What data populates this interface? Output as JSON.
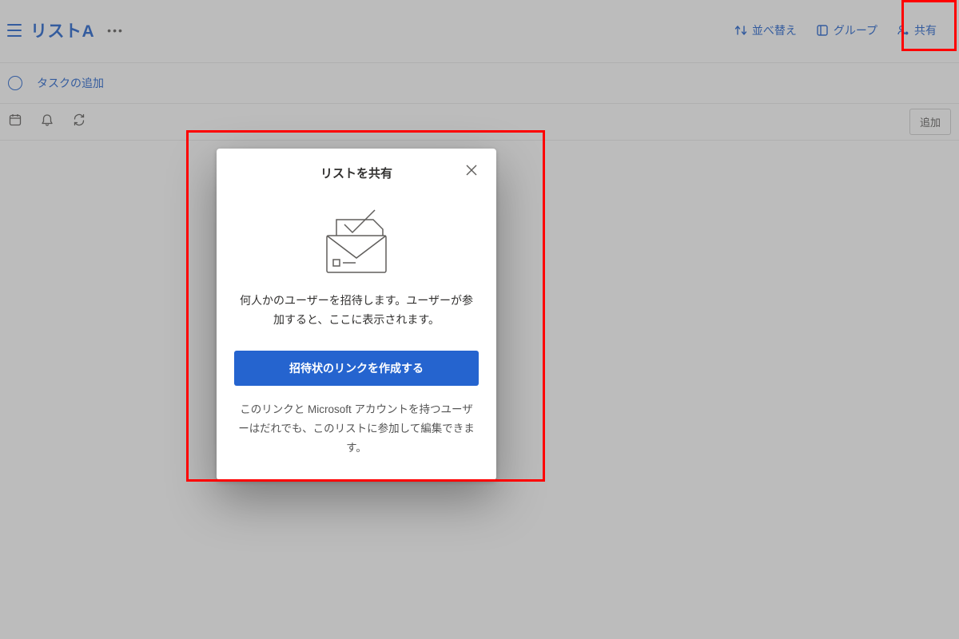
{
  "header": {
    "list_title": "リストA",
    "actions": {
      "sort": "並べ替え",
      "group": "グループ",
      "share": "共有"
    }
  },
  "add_task": {
    "placeholder": "タスクの追加"
  },
  "action_row": {
    "add_button": "追加"
  },
  "share_dialog": {
    "title": "リストを共有",
    "description": "何人かのユーザーを招待します。ユーザーが参加すると、ここに表示されます。",
    "primary_button": "招待状のリンクを作成する",
    "footer_text": "このリンクと Microsoft アカウントを持つユーザーはだれでも、このリストに参加して編集できます。"
  }
}
